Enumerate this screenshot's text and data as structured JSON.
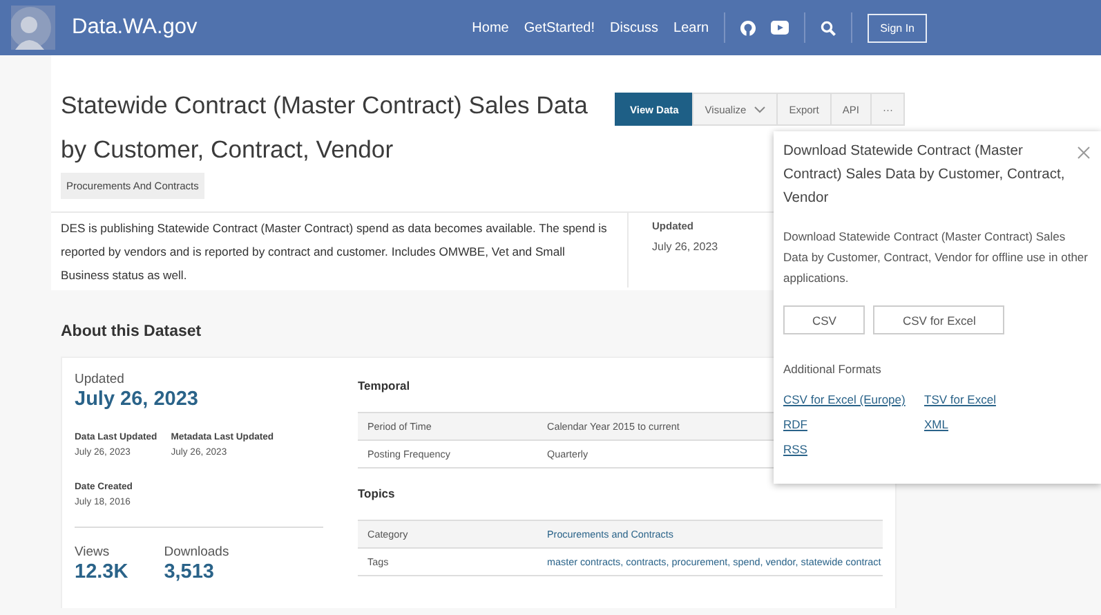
{
  "header": {
    "site_name": "Data.WA.gov",
    "nav": [
      "Home",
      "GetStarted!",
      "Discuss",
      "Learn"
    ],
    "sign_in": "Sign In"
  },
  "dataset": {
    "title": "Statewide Contract (Master Contract) Sales Data by Customer, Contract, Vendor",
    "category_tag": "Procurements And Contracts",
    "description": "DES is publishing Statewide Contract (Master Contract) spend as data becomes available. The spend is reported by vendors and is reported by contract and customer. Includes OMWBE, Vet and Small Business status as well.",
    "updated_label": "Updated",
    "updated_value": "July 26, 2023"
  },
  "actions": [
    {
      "label": "View Data",
      "kind": "primary"
    },
    {
      "label": "Visualize",
      "kind": "dropdown"
    },
    {
      "label": "Export",
      "kind": "plain"
    },
    {
      "label": "API",
      "kind": "plain"
    },
    {
      "label": "···",
      "kind": "more"
    }
  ],
  "download_popover": {
    "title": "Download Statewide Contract (Master Contract) Sales Data by Customer, Contract, Vendor",
    "description": "Download Statewide Contract (Master Contract) Sales Data by Customer, Contract, Vendor for offline use in other applications.",
    "buttons": [
      "CSV",
      "CSV for Excel"
    ],
    "additional_label": "Additional Formats",
    "links": [
      "CSV for Excel (Europe)",
      "TSV for Excel",
      "RDF",
      "XML",
      "RSS"
    ]
  },
  "about": {
    "heading": "About this Dataset",
    "updated_label": "Updated",
    "updated_value": "July 26, 2023",
    "dates": [
      {
        "label": "Data Last Updated",
        "value": "July 26, 2023"
      },
      {
        "label": "Metadata Last Updated",
        "value": "July 26, 2023"
      },
      {
        "label": "Date Created",
        "value": "July 18, 2016"
      }
    ],
    "stats": [
      {
        "label": "Views",
        "value": "12.3K"
      },
      {
        "label": "Downloads",
        "value": "3,513"
      }
    ],
    "sections": [
      {
        "heading": "Temporal",
        "rows": [
          {
            "label": "Period of Time",
            "value": "Calendar Year 2015 to current"
          },
          {
            "label": "Posting Frequency",
            "value": "Quarterly"
          }
        ]
      },
      {
        "heading": "Topics",
        "rows": [
          {
            "label": "Category",
            "value": "Procurements and Contracts"
          },
          {
            "label": "Tags",
            "value": "master contracts, contracts, procurement, spend, vendor, statewide contract"
          }
        ]
      }
    ]
  }
}
